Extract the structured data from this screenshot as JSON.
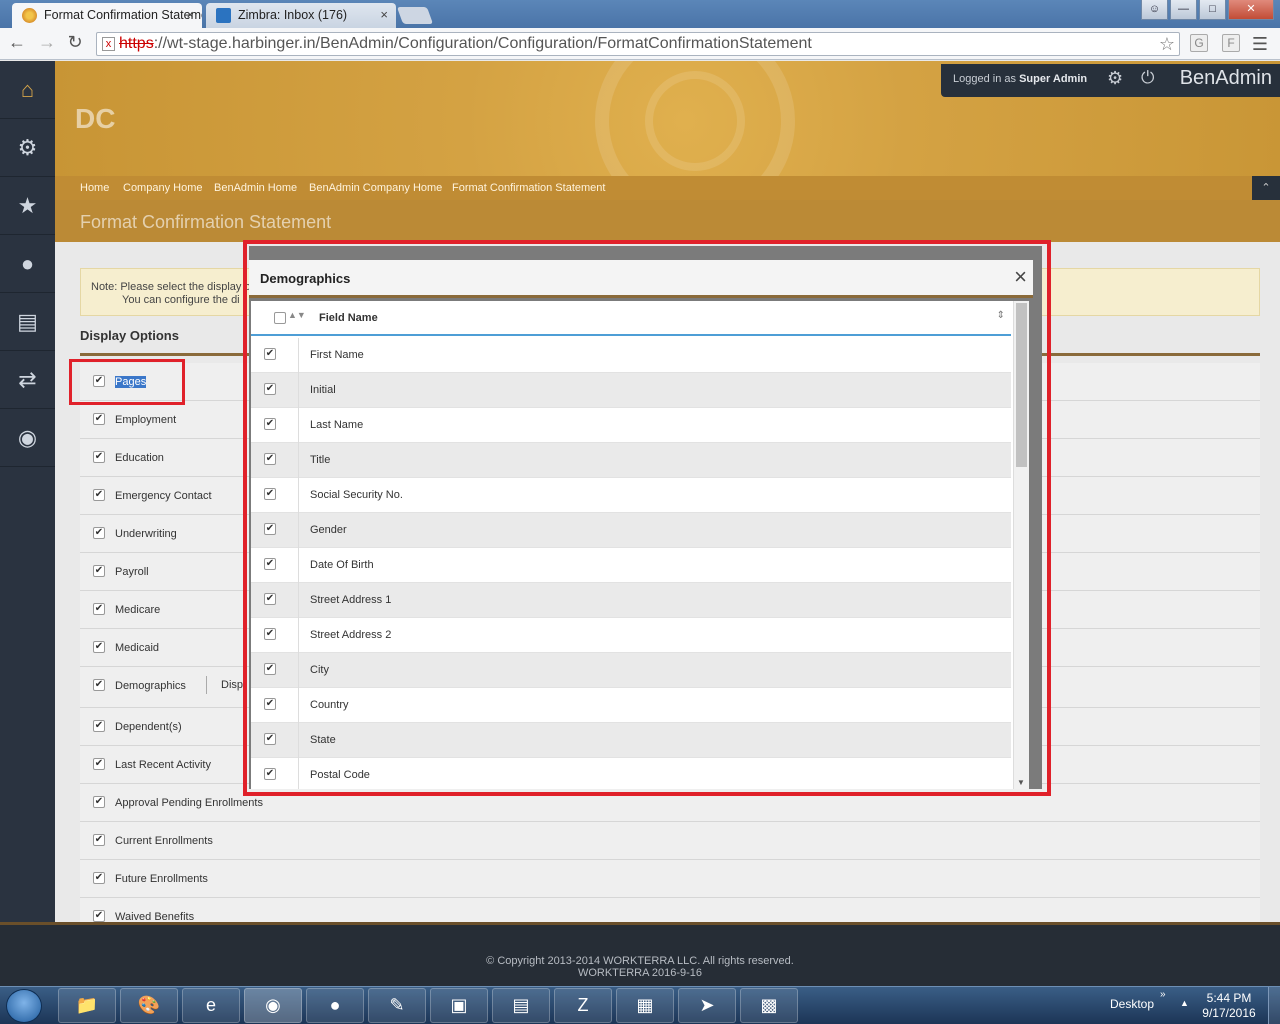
{
  "browser": {
    "tabs": [
      {
        "title": "Format Confirmation Statement",
        "active": true
      },
      {
        "title": "Zimbra: Inbox (176)",
        "active": false
      }
    ],
    "url_scheme": "https",
    "url_rest": "://wt-stage.harbinger.in/BenAdmin/Configuration/Configuration/FormatConfirmationStatement",
    "tab_close": "×",
    "ext1": "G",
    "ext2": "F"
  },
  "app": {
    "company": "DC",
    "logged_in_prefix": "Logged in as ",
    "user": "Super Admin",
    "brand": "BenAdmin",
    "breadcrumb": [
      "Home",
      "Company Home",
      "BenAdmin Home",
      "BenAdmin Company Home",
      "Format Confirmation Statement"
    ],
    "page_title": "Format Confirmation Statement",
    "note_line1": "Note: Please select the display o",
    "note_line2": "You can configure the di",
    "section_title": "Display Options",
    "options": [
      {
        "label": "Pages",
        "checked": true
      },
      {
        "label": "Employment",
        "checked": true
      },
      {
        "label": "Education",
        "checked": true
      },
      {
        "label": "Emergency Contact",
        "checked": true
      },
      {
        "label": "Underwriting",
        "checked": true
      },
      {
        "label": "Payroll",
        "checked": true
      },
      {
        "label": "Medicare",
        "checked": true
      },
      {
        "label": "Medicaid",
        "checked": true
      },
      {
        "label": "Demographics",
        "checked": true
      },
      {
        "label": "Dependent(s)",
        "checked": true
      },
      {
        "label": "Last Recent Activity",
        "checked": true
      },
      {
        "label": "Approval Pending Enrollments",
        "checked": true
      },
      {
        "label": "Current Enrollments",
        "checked": true
      },
      {
        "label": "Future Enrollments",
        "checked": true
      },
      {
        "label": "Waived Benefits",
        "checked": true
      }
    ],
    "demographics_extra": "Disp"
  },
  "modal": {
    "title": "Demographics",
    "column_header": "Field Name",
    "close": "×",
    "fields": [
      "First Name",
      "Initial",
      "Last Name",
      "Title",
      "Social Security No.",
      "Gender",
      "Date Of Birth",
      "Street Address 1",
      "Street Address 2",
      "City",
      "Country",
      "State",
      "Postal Code"
    ]
  },
  "footer": {
    "copyright": "© Copyright 2013-2014 WORKTERRA LLC. All rights reserved.",
    "version": "WORKTERRA 2016-9-16"
  },
  "taskbar": {
    "desktop_label": "Desktop",
    "time": "5:44 PM",
    "date": "9/17/2016"
  },
  "colors": {
    "accent_gold": "#c89535",
    "highlight_red": "#e0212a",
    "nav_dark": "#2a3340"
  }
}
